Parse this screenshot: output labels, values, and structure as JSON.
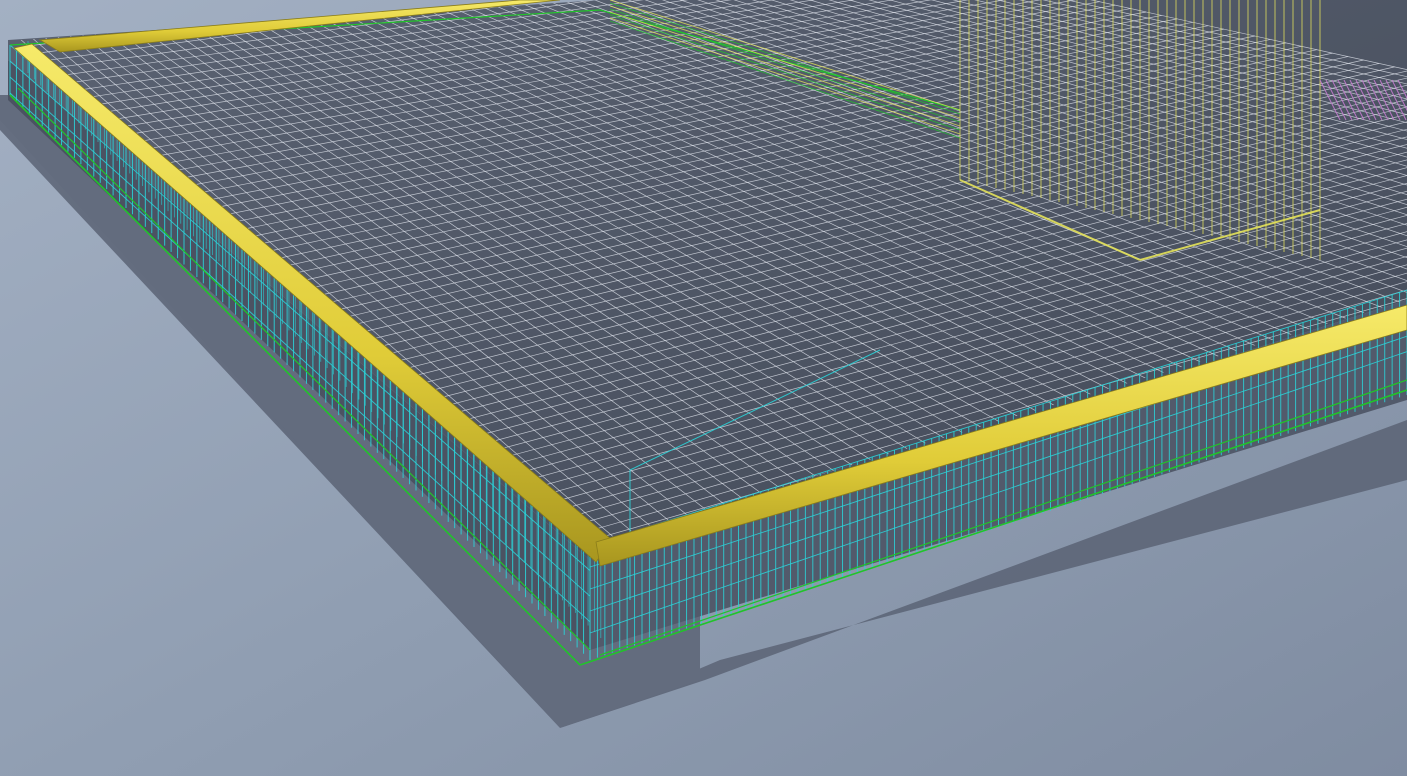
{
  "viewport": {
    "view": "3d-perspective",
    "background_color": "#8e9db2",
    "slab_color": "#4a5262",
    "shadow_color": "#5f6778"
  },
  "rebar": {
    "top_mesh_color": "#e6eaf2",
    "edge_stirrup_color": "#2bd3d8",
    "bottom_longitudinal_color": "#21c42a",
    "edge_beam_color": "#e8d64a",
    "column_cage_color": "#e4e25a",
    "opening_color": "#c77bd0"
  }
}
